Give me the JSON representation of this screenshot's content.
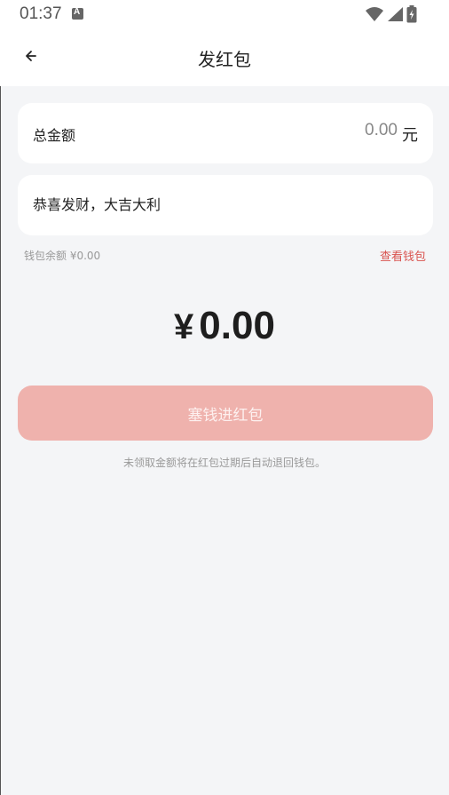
{
  "status_bar": {
    "time": "01:37",
    "icons": [
      "notification-a-icon",
      "wifi-icon",
      "signal-icon",
      "battery-icon"
    ]
  },
  "header": {
    "back_icon": "arrow-left-icon",
    "title": "发红包"
  },
  "amount": {
    "label": "总金额",
    "value": "0.00",
    "unit": "元"
  },
  "greeting": {
    "placeholder": "恭喜发财，大吉大利"
  },
  "wallet": {
    "balance_text": "钱包余额 ¥0.00",
    "view_link": "查看钱包"
  },
  "display_amount": {
    "currency": "¥",
    "value": "0.00"
  },
  "submit": {
    "label": "塞钱进红包"
  },
  "footnote": "未领取金额将在红包过期后自动退回钱包。",
  "colors": {
    "accent": "#d9534f",
    "button_disabled": "#efb2ad",
    "background": "#f4f5f7"
  }
}
